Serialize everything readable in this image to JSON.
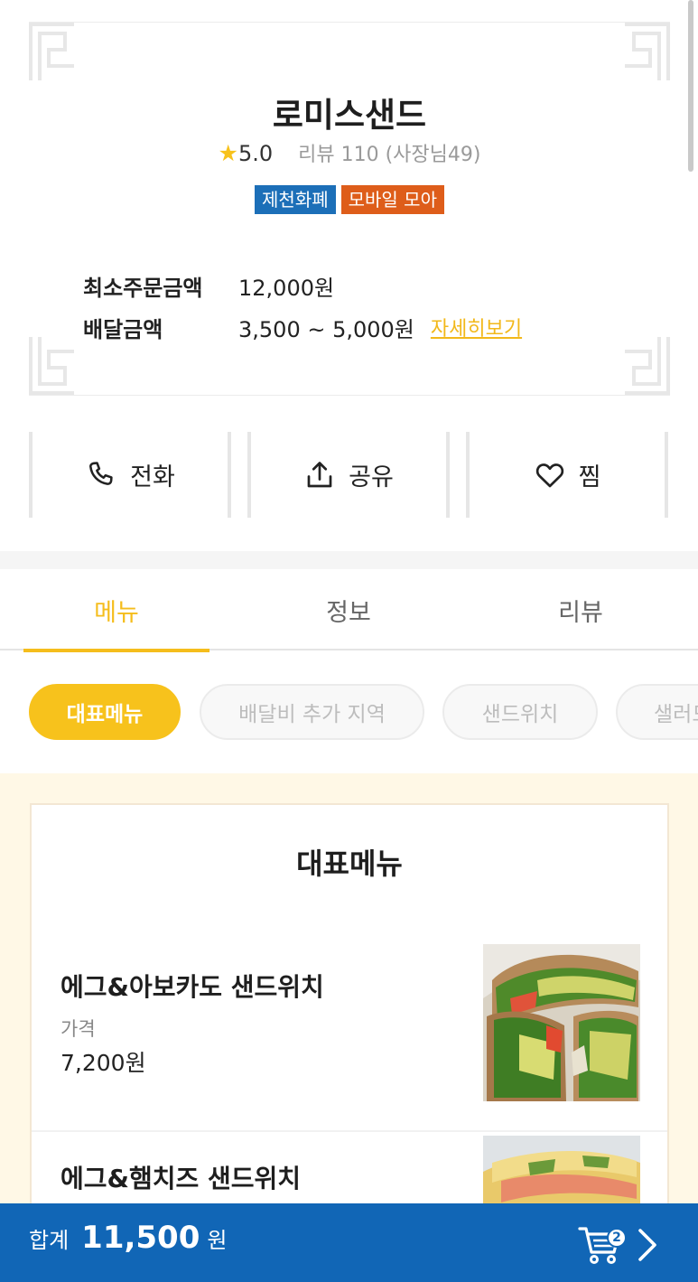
{
  "store": {
    "name": "로미스샌드",
    "rating": "5.0",
    "review_summary": "리뷰 110 (사장님49)",
    "badges": [
      "제천화폐",
      "모바일 모아"
    ],
    "min_order_label": "최소주문금액",
    "min_order_value": "12,000원",
    "delivery_fee_label": "배달금액",
    "delivery_fee_value": "3,500 ~ 5,000원",
    "detail_link": "자세히보기"
  },
  "actions": {
    "call": "전화",
    "share": "공유",
    "like": "찜"
  },
  "tabs": [
    {
      "label": "메뉴",
      "active": true
    },
    {
      "label": "정보",
      "active": false
    },
    {
      "label": "리뷰",
      "active": false
    }
  ],
  "categories": [
    "대표메뉴",
    "배달비 추가 지역",
    "샌드위치",
    "샐러드"
  ],
  "menu_section": {
    "title": "대표메뉴",
    "items": [
      {
        "name": "에그&아보카도 샌드위치",
        "price_label": "가격",
        "price": "7,200원"
      },
      {
        "name": "에그&햄치즈 샌드위치"
      }
    ]
  },
  "cart": {
    "total_label": "합계",
    "total_amount": "11,500",
    "unit": "원",
    "item_count": "2"
  },
  "colors": {
    "accent_yellow": "#f7c21c",
    "cart_blue": "#1166b6",
    "badge_blue": "#1c6fb8",
    "badge_orange": "#de5d1a",
    "menu_background": "#fff8e6"
  }
}
